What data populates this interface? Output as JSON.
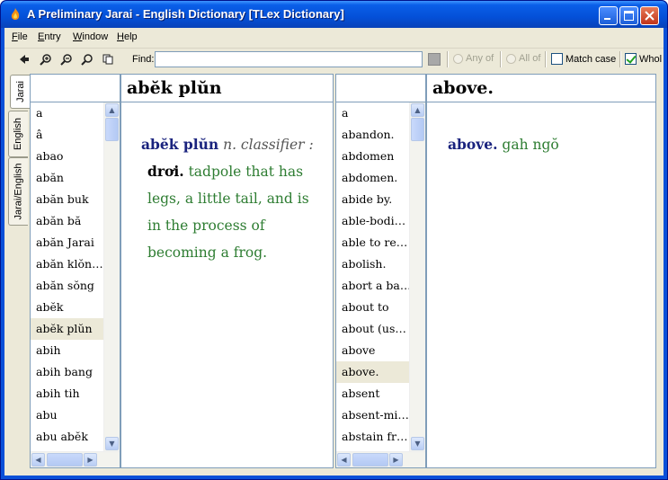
{
  "window": {
    "title": "A Preliminary Jarai - English Dictionary [TLex Dictionary]",
    "buttons": [
      "minimize-icon",
      "maximize-icon",
      "close-icon"
    ]
  },
  "menu": [
    {
      "label": "File",
      "accel": "F",
      "rest": "ile"
    },
    {
      "label": "Entry",
      "accel": "E",
      "rest": "ntry"
    },
    {
      "label": "Window",
      "accel": "W",
      "rest": "indow"
    },
    {
      "label": "Help",
      "accel": "H",
      "rest": "elp"
    }
  ],
  "toolbar": {
    "find_label": "Find:",
    "find_value": "",
    "any_of": "Any of",
    "all_of": "All of",
    "match_case": "Match case",
    "match_case_checked": false,
    "whole": "Whol",
    "whole_checked": true,
    "icons": [
      "back-icon",
      "zoom-in-icon",
      "zoom-out-icon",
      "zoom-reset-icon",
      "copy-icon"
    ]
  },
  "tabs": [
    "Jarai",
    "English",
    "Jarai/English"
  ],
  "active_tab": "Jarai",
  "left_list": {
    "items": [
      "a",
      "â",
      "abao",
      "abăn",
      "abăn buk",
      "abăn bă",
      "abăn Jarai",
      "abăn klŏn…",
      "abăn sŏng",
      "abĕk",
      "abĕk plŭn",
      "abih",
      "abih bang",
      "abih tih",
      "abu",
      "abu abĕk"
    ],
    "selected": "abĕk plŭn"
  },
  "left_entry": {
    "headword": "abĕk plŭn",
    "sense_headword": "abĕk plŭn",
    "pos": "n. classifier :",
    "classifier": "drơi.",
    "line1_gloss": "tadpole that has",
    "line2": "legs, a little tail, and is",
    "line3": "in the process of",
    "line4": "becoming a frog."
  },
  "right_list": {
    "items": [
      "a",
      "abandon.",
      "abdomen",
      "abdomen.",
      "abide by.",
      "able-bodi…",
      "able to re…",
      "abolish.",
      "abort a ba…",
      "about to",
      "about (us…",
      "above",
      "above.",
      "absent",
      "absent-mi…",
      "abstain fr…"
    ],
    "selected": "above."
  },
  "right_entry": {
    "headword": "above.",
    "sense_headword": "above.",
    "gloss": "gah ngŏ"
  }
}
